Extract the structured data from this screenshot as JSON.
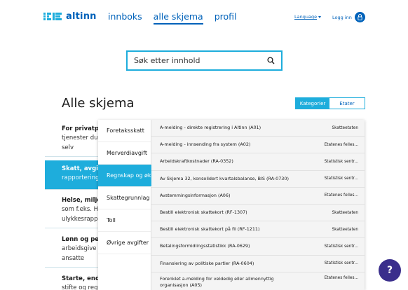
{
  "header": {
    "logo_text": "altinn",
    "nav": [
      {
        "label": "innboks"
      },
      {
        "label": "alle skjema"
      },
      {
        "label": "profil"
      }
    ],
    "language": "Language",
    "login": "Logg inn"
  },
  "search": {
    "placeholder": "Søk etter innhold"
  },
  "page_title": "Alle skjema",
  "toggle": {
    "kategorier": "Kategorier",
    "etater": "Etater"
  },
  "categories": [
    {
      "title": "For privatpe",
      "desc": [
        "tjenester du",
        "selv"
      ]
    },
    {
      "title": "Skatt, avgif",
      "desc": [
        "rapportering"
      ]
    },
    {
      "title": "Helse, milje",
      "desc": [
        "som f.eks. H",
        "ulykkesrapp"
      ]
    },
    {
      "title": "Lønn og per",
      "desc": [
        "arbeidsgive",
        "ansatte"
      ]
    },
    {
      "title": "Starte, endr",
      "desc": [
        "stifte og reg"
      ]
    }
  ],
  "subcategories": [
    {
      "label": "Foretaksskatt"
    },
    {
      "label": "Merverdiavgift"
    },
    {
      "label": "Regnskap og øk"
    },
    {
      "label": "Skattegrunnlag"
    },
    {
      "label": "Toll"
    },
    {
      "label": "Øvrige avgifter"
    }
  ],
  "forms": [
    {
      "name": "A-melding - direkte registrering i Altinn (A01)",
      "owner": "Skatteetaten"
    },
    {
      "name": "A-melding - innsending fra system (A02)",
      "owner": "Etatenes felles..."
    },
    {
      "name": "Arbeidskraftkostnader (RA-0352)",
      "owner": "Statistisk sentr..."
    },
    {
      "name": "Av Skjema 32, konsolidert kvartalsbalanse, BIS (RA-0730)",
      "owner": "Statistisk sentr..."
    },
    {
      "name": "Avstemmingsinformasjon (A06)",
      "owner": "Etatenes felles..."
    },
    {
      "name": "Bestill elektronisk skattekort (RF-1307)",
      "owner": "Skatteetaten"
    },
    {
      "name": "Bestill elektronisk skattekort på fil (RF-1211)",
      "owner": "Skatteetaten"
    },
    {
      "name": "Betalingsformidlingsstatistikk (RA-0629)",
      "owner": "Statistisk sentr..."
    },
    {
      "name": "Finansiering av politiske partier (RA-0604)",
      "owner": "Statistisk sentr..."
    },
    {
      "name": "Forenklet a-melding for veldedig eller allmennyttig organisasjon (A05)",
      "owner": "Etatenes felles..."
    }
  ],
  "help": "?",
  "colors": {
    "primary": "#0062ba",
    "accent": "#1eaddc",
    "help": "#3a2e8c"
  }
}
